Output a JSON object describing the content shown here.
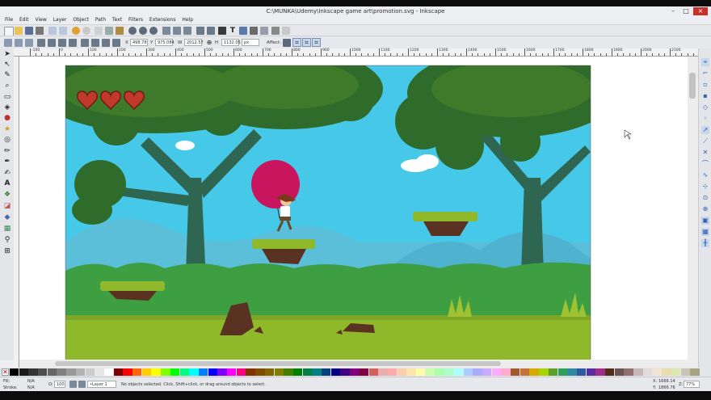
{
  "window": {
    "title": "C:\\MUNKA\\Udemy\\Inkscape game art\\promotion.svg - Inkscape",
    "controls": {
      "minimize": "–",
      "maximize": "□",
      "close": "×"
    }
  },
  "menu": [
    "File",
    "Edit",
    "View",
    "Layer",
    "Object",
    "Path",
    "Text",
    "Filters",
    "Extensions",
    "Help"
  ],
  "toolbar": {
    "x_label": "X",
    "x_value": "498.78",
    "y_label": "Y",
    "y_value": "975.084",
    "w_label": "W",
    "w_value": "2012.57",
    "h_label": "H",
    "h_value": "1132.05",
    "unit": "px",
    "affect_label": "Affect:"
  },
  "ruler": {
    "ticks": [
      "-100",
      "0",
      "100",
      "200",
      "300",
      "400",
      "500",
      "600",
      "700",
      "800",
      "900",
      "1000",
      "1100",
      "1200",
      "1300",
      "1400",
      "1500",
      "1600",
      "1700",
      "1800",
      "1900",
      "2000",
      "2100",
      "2200"
    ]
  },
  "palette_colors": [
    "#000000",
    "#1a1a1a",
    "#333333",
    "#4d4d4d",
    "#666666",
    "#808080",
    "#999999",
    "#b3b3b3",
    "#cccccc",
    "#e6e6e6",
    "#ffffff",
    "#800000",
    "#ff0000",
    "#ff6600",
    "#ffcc00",
    "#ffff00",
    "#80ff00",
    "#00ff00",
    "#00ff80",
    "#00ffff",
    "#0080ff",
    "#0000ff",
    "#8000ff",
    "#ff00ff",
    "#ff0080",
    "#803300",
    "#804d00",
    "#806600",
    "#808000",
    "#408000",
    "#008000",
    "#008040",
    "#008080",
    "#004080",
    "#000080",
    "#400080",
    "#800080",
    "#800040",
    "#d35f5f",
    "#e9afaf",
    "#ffaaaa",
    "#ffccaa",
    "#ffe6aa",
    "#ffffaa",
    "#ccffaa",
    "#aaffaa",
    "#aaffcc",
    "#aaffff",
    "#aaccff",
    "#aaaaff",
    "#ccaaff",
    "#ffaaff",
    "#ffaacc",
    "#a05a2c",
    "#c87137",
    "#d4aa00",
    "#aad400",
    "#5aa02c",
    "#2ca05a",
    "#2c89a0",
    "#2c5aa0",
    "#5a2ca0",
    "#a02c89",
    "#502d16",
    "#6c5353",
    "#916f6f",
    "#c8b7b7",
    "#e3dbdb",
    "#f4e3d7",
    "#e9ddaf",
    "#dde9af",
    "#c8c4b7",
    "#a7a37e"
  ],
  "status": {
    "fill_label": "Fill:",
    "fill_value": "N/A",
    "stroke_label": "Stroke:",
    "stroke_value": "N/A",
    "opacity_label": "O:",
    "opacity_value": "100",
    "layer": "•Layer 1",
    "message": "No objects selected. Click, Shift+click, or drag around objects to select.",
    "x_label": "X:",
    "x_value": "1666.14",
    "y_label": "Y:",
    "y_value": "1866.76",
    "z_label": "Z:",
    "zoom": "77%"
  },
  "colors": {
    "sky": "#46c8e8",
    "foliage_dark": "#2f6b2a",
    "trunk": "#2e6652",
    "grass_light": "#8fb82a",
    "grass_mid": "#3d9e42",
    "heart": "#c0392b",
    "balloon": "#c8155d",
    "rock": "#5a3222"
  }
}
